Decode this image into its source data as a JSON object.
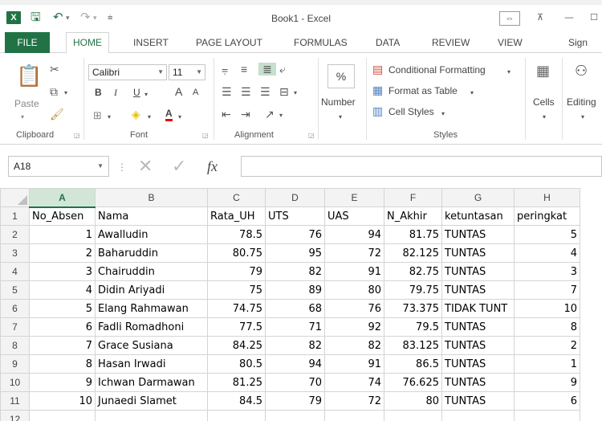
{
  "window": {
    "app_icon": "X",
    "title": "Book1 - Excel",
    "controls": [
      "⇔",
      "⊼",
      "—",
      "☐"
    ]
  },
  "ribbon_tabs": [
    "FILE",
    "HOME",
    "INSERT",
    "PAGE LAYOUT",
    "FORMULAS",
    "DATA",
    "REVIEW",
    "VIEW",
    "Sign in"
  ],
  "ribbon": {
    "clipboard": {
      "paste_label": "Paste",
      "group_label": "Clipboard"
    },
    "font": {
      "font_name": "Calibri",
      "font_size": "11",
      "bold": "B",
      "italic": "I",
      "underline": "U",
      "grow": "A",
      "shrink": "A",
      "font_color": "A",
      "group_label": "Font"
    },
    "alignment": {
      "group_label": "Alignment"
    },
    "number": {
      "percent": "%",
      "label": "Number"
    },
    "styles": {
      "conditional_formatting": "Conditional Formatting",
      "format_as_table": "Format as Table",
      "cell_styles": "Cell Styles",
      "group_label": "Styles"
    },
    "cells": {
      "label": "Cells"
    },
    "editing": {
      "label": "Editing"
    }
  },
  "formula_bar": {
    "name_box": "A18",
    "fx": "fx",
    "value": ""
  },
  "sheet": {
    "columns": [
      "A",
      "B",
      "C",
      "D",
      "E",
      "F",
      "G",
      "H"
    ],
    "selected_column": "A",
    "rows": [
      {
        "n": "1",
        "cells": [
          "No_Absen",
          "Nama",
          "Rata_UH",
          "UTS",
          "UAS",
          "N_Akhir",
          "ketuntasan",
          "peringkat"
        ]
      },
      {
        "n": "2",
        "cells": [
          "1",
          "Awalludin",
          "78.5",
          "76",
          "94",
          "81.75",
          "TUNTAS",
          "5"
        ]
      },
      {
        "n": "3",
        "cells": [
          "2",
          "Baharuddin",
          "80.75",
          "95",
          "72",
          "82.125",
          "TUNTAS",
          "4"
        ]
      },
      {
        "n": "4",
        "cells": [
          "3",
          "Chairuddin",
          "79",
          "82",
          "91",
          "82.75",
          "TUNTAS",
          "3"
        ]
      },
      {
        "n": "5",
        "cells": [
          "4",
          "Didin Ariyadi",
          "75",
          "89",
          "80",
          "79.75",
          "TUNTAS",
          "7"
        ]
      },
      {
        "n": "6",
        "cells": [
          "5",
          "Elang Rahmawan",
          "74.75",
          "68",
          "76",
          "73.375",
          "TIDAK TUNT",
          "10"
        ]
      },
      {
        "n": "7",
        "cells": [
          "6",
          "Fadli Romadhoni",
          "77.5",
          "71",
          "92",
          "79.5",
          "TUNTAS",
          "8"
        ]
      },
      {
        "n": "8",
        "cells": [
          "7",
          "Grace Susiana",
          "84.25",
          "82",
          "82",
          "83.125",
          "TUNTAS",
          "2"
        ]
      },
      {
        "n": "9",
        "cells": [
          "8",
          "Hasan Irwadi",
          "80.5",
          "94",
          "91",
          "86.5",
          "TUNTAS",
          "1"
        ]
      },
      {
        "n": "10",
        "cells": [
          "9",
          "Ichwan Darmawan",
          "81.25",
          "70",
          "74",
          "76.625",
          "TUNTAS",
          "9"
        ]
      },
      {
        "n": "11",
        "cells": [
          "10",
          "Junaedi Slamet",
          "84.5",
          "79",
          "72",
          "80",
          "TUNTAS",
          "6"
        ]
      },
      {
        "n": "12",
        "cells": [
          "",
          "",
          "",
          "",
          "",
          "",
          "",
          ""
        ]
      }
    ]
  },
  "colors": {
    "accent": "#217346",
    "header_bg": "#f3f3f3",
    "gridline": "#d4d4d4"
  }
}
